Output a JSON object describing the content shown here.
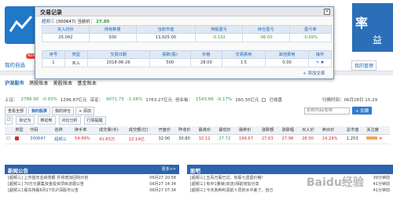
{
  "app": {
    "brand_big": "率",
    "brand_small": "益"
  },
  "nav": {
    "my_self_selected": "我的自选",
    "new_badge": "NEW",
    "right_link": "我的管理"
  },
  "market_tabs": [
    "沪深股市",
    "港股账本",
    "美股账本",
    "基金账本"
  ],
  "index_line": {
    "sh_label": "上证：",
    "sh_value": "2786.90",
    "sh_change": "-0.93%",
    "sh_amount": "1296.87亿元",
    "sz_label": "深证：",
    "sz_value": "9071.73",
    "sz_change": "-1.06%",
    "sz_amount": "1763.27亿元",
    "cy_label": "创业板：",
    "cy_value": "1543.66",
    "cy_change": "-0.17%",
    "cy_amount": "160.35亿元",
    "sync_label": "已收盘",
    "time_label": "行情时间：",
    "time_value": "06月28日 15:29"
  },
  "view_tabs": [
    "查看全部",
    "我的股票",
    "我的持仓",
    "+ 添加"
  ],
  "toolbar": {
    "tag_btn": "标记为",
    "move_btn": "移动到",
    "cmp_btn": "对比分析",
    "quote_btn": "行情提醒"
  },
  "search": {
    "placeholder": "名称/代码/名称",
    "add_label": "+ 加票"
  },
  "stock_table": {
    "headers": [
      "",
      "类型",
      "代码",
      "名称",
      "换手率",
      "成交量(手)",
      "成交额(亿)",
      "开盘价",
      "昨收价",
      "最高价",
      "最低价",
      "最新价",
      "涨跌额",
      "涨跌幅",
      "买入价",
      "卖出价",
      "总市值",
      "关注度"
    ],
    "row": [
      "",
      "",
      "300647",
      "超频三",
      "54.49%",
      "41.65万",
      "12.14亿",
      "32.00",
      "30.80",
      "32.12",
      "27.72",
      "199.67",
      "27.63",
      "27.98",
      "28.00",
      "14.29%",
      "1,253",
      ""
    ]
  },
  "news": {
    "title": "新闻公告",
    "more": "更多>>",
    "items": [
      {
        "text": "[超频三] 上市首年业绩亮眼 并将增加回购计划",
        "date": "06月27 20:58"
      },
      {
        "text": "[超频三] 70万元募集资金投资项目进展公告",
        "date": "06月27 14:34"
      },
      {
        "text": "[超频三] 股东持股6月27日沪深股市公告",
        "date": "06月27 07:34"
      }
    ]
  },
  "tips": {
    "title": "股吧",
    "items": [
      {
        "text": "[超频三] 五百万股已过，有股七遗留价格！",
        "date": "39分钟前"
      },
      {
        "text": "[超频三] 有中1量级(双流)相前增加分享",
        "date": "41分钟前"
      },
      {
        "text": "[超频三] 今天各种利润前人员的水平差了，自己",
        "date": "41分钟前"
      }
    ]
  },
  "dialog": {
    "title": "交易记录",
    "close": "×",
    "stock_name": "超频三",
    "stock_code": "(300647)",
    "latest_label": "当前价：",
    "latest_value": "27.85",
    "summary_headers": [
      "买入均价",
      "持有数量",
      "当前市值",
      "持股盈亏",
      "持仓盈亏",
      "盈亏率"
    ],
    "summary_values": [
      "25.042",
      "500",
      "13,925.00",
      "-0.192",
      "-96.00",
      "-0.69%"
    ],
    "trade_headers": [
      "序号",
      "类型",
      "交易日期",
      "股数(股)",
      "价格",
      "交易费用",
      "其他费用",
      "操作"
    ],
    "trade_row": [
      "1",
      "买入",
      "2018-06-26",
      "500",
      "28.00",
      "1.5",
      "0.00",
      ""
    ],
    "add_trade": "+ 添加交易"
  },
  "watermark": "Baidu经验",
  "colors": {
    "accent_blue": "#1f63b4",
    "panel_head": "#2c64ae",
    "up_red": "#d6281c",
    "down_green": "#2a9d3a"
  }
}
